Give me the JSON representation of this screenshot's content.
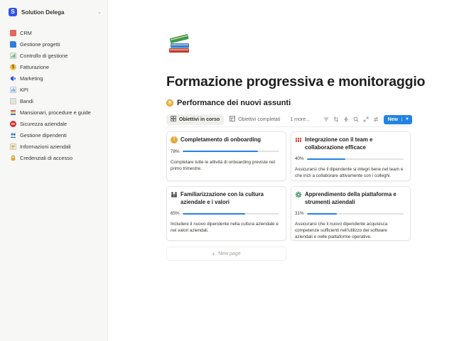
{
  "sidebar": {
    "workspace": "Solution Delega",
    "items": [
      {
        "label": "CRM",
        "icon": "crm-icon",
        "color": "#e16259"
      },
      {
        "label": "Gestione progetti",
        "icon": "folder-icon",
        "color": "#2f7fd6"
      },
      {
        "label": "Controllo di gestione",
        "icon": "chart-icon",
        "color": "#4a9c6d"
      },
      {
        "label": "Fatturazione",
        "icon": "money-bag-icon",
        "color": "#e3a72f"
      },
      {
        "label": "Marketing",
        "icon": "marketing-icon",
        "color": "#2f54eb"
      },
      {
        "label": "KPI",
        "icon": "kpi-icon",
        "color": "#6b8fd6"
      },
      {
        "label": "Bandi",
        "icon": "bandi-icon",
        "color": "#9b9a97"
      },
      {
        "label": "Mansionari, procedure e guide",
        "icon": "guide-icon",
        "color": "#d9534f"
      },
      {
        "label": "Sicurezza aziendale",
        "icon": "no-entry-icon",
        "color": "#d9302c"
      },
      {
        "label": "Gestione dipendenti",
        "icon": "people-icon",
        "color": "#2f7fd6"
      },
      {
        "label": "Informazioni aziendali",
        "icon": "memo-icon",
        "color": "#c99a3a"
      },
      {
        "label": "Credenziali di accesso",
        "icon": "lock-icon",
        "color": "#e3a72f"
      }
    ]
  },
  "page": {
    "icon": "books-icon",
    "title": "Formazione progressiva e monitoraggio",
    "database_title": "Performance dei nuovi assunti"
  },
  "views": {
    "tabs": [
      {
        "label": "Obiettivi in corso",
        "icon": "board-icon",
        "active": true
      },
      {
        "label": "Obiettivi completati",
        "icon": "table-icon",
        "active": false
      },
      {
        "label": "1 more...",
        "icon": "",
        "active": false
      }
    ],
    "new_label": "New"
  },
  "cards": [
    {
      "title": "Completamento di onboarding",
      "icon": "exclamation-icon",
      "percent": 78,
      "percent_label": "78%",
      "description": "Completare tutte le attività di onboarding previste nel primo trimestre."
    },
    {
      "title": "Integrazione con il team e collaborazione efficace",
      "icon": "team-icon",
      "percent": 40,
      "percent_label": "40%",
      "description": "Assicurarsi che il dipendente si integri bene nel team e che inizi a collaborare attivamente con i colleghi."
    },
    {
      "title": "Familiarizzazione con la cultura aziendale e i valori",
      "icon": "family-icon",
      "percent": 65,
      "percent_label": "65%",
      "description": "Includere il nuovo dipendente nella cultura aziendale e nei valori aziendali."
    },
    {
      "title": "Apprendimento della piattaforma e strumenti aziendali",
      "icon": "gear-icon",
      "percent": 31,
      "percent_label": "31%",
      "description": "Assicurarsi che il nuovo dipendente acquisisca competenze sufficienti nell'utilizzo dei software aziendali e nelle piattaforme operative."
    }
  ],
  "new_page_label": "New page",
  "colors": {
    "accent": "#2383e2",
    "sidebar_bg": "#f7f7f5"
  }
}
